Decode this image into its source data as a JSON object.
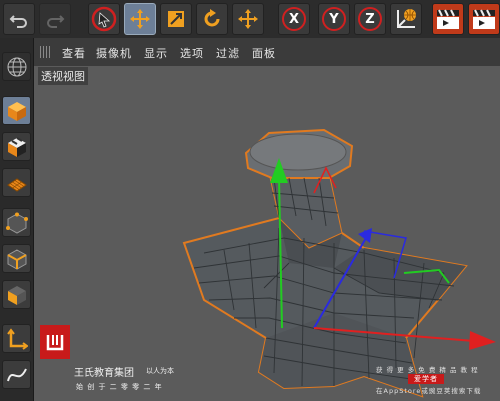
{
  "menu": {
    "items": [
      {
        "label": "查看"
      },
      {
        "label": "摄像机"
      },
      {
        "label": "显示"
      },
      {
        "label": "选项"
      },
      {
        "label": "过滤"
      },
      {
        "label": "面板"
      }
    ]
  },
  "viewport": {
    "label": "透视视图"
  },
  "toolbar": {
    "x_label": "X",
    "y_label": "Y",
    "z_label": "Z"
  },
  "watermark": {
    "brand": "王氏教育集团",
    "motto": "以人为本",
    "tagline": "始 创 于 二 零 零 二 年",
    "promo_top": "获 得 更 多 免 费 精 品 教 程",
    "promo_app": "爱学者",
    "promo_bottom": "在AppStore或豌豆荚搜索下载"
  },
  "colors": {
    "axis_x": "#e02020",
    "axis_y": "#22cc22",
    "axis_z": "#2a2ae0",
    "selection": "#e07a20",
    "brand_red": "#c81a1a"
  }
}
